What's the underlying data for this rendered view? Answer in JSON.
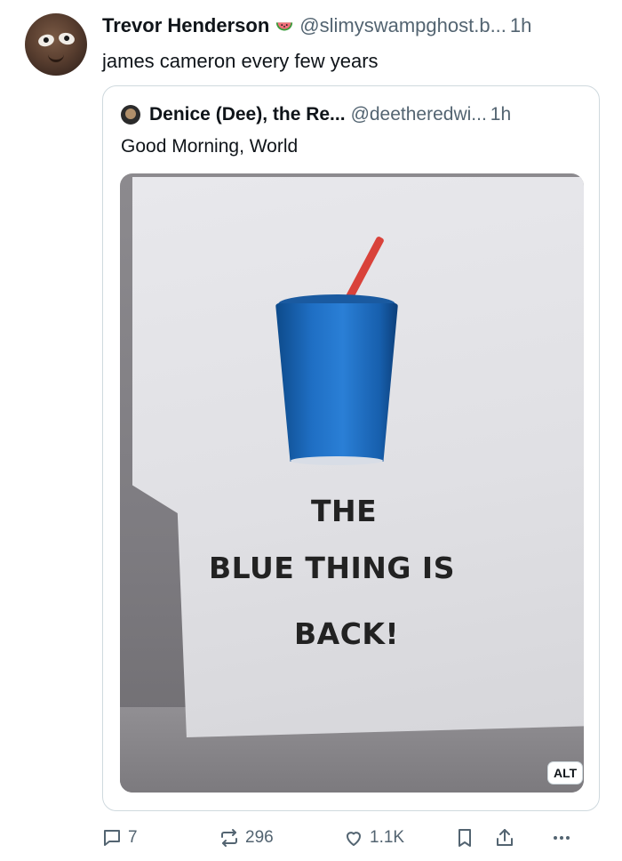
{
  "post": {
    "author_name": "Trevor Henderson",
    "author_handle": "@slimyswampghost.b...",
    "time": "1h",
    "text": "james cameron every few years"
  },
  "quote": {
    "author_name": "Denice (Dee), the Re...",
    "author_handle": "@deetheredwi...",
    "time": "1h",
    "text": "Good Morning, World"
  },
  "image": {
    "sign_lines": [
      "THE",
      "BLUE THING IS",
      "BACK!"
    ],
    "alt_label": "ALT"
  },
  "actions": {
    "replies": "7",
    "reposts": "296",
    "likes": "1.1K"
  },
  "icons": {
    "reply": "reply-icon",
    "repost": "repost-icon",
    "like": "heart-icon",
    "bookmark": "bookmark-icon",
    "share": "share-icon",
    "more": "more-icon"
  },
  "colors": {
    "secondary_text": "#536471",
    "border": "#cfd9de"
  }
}
